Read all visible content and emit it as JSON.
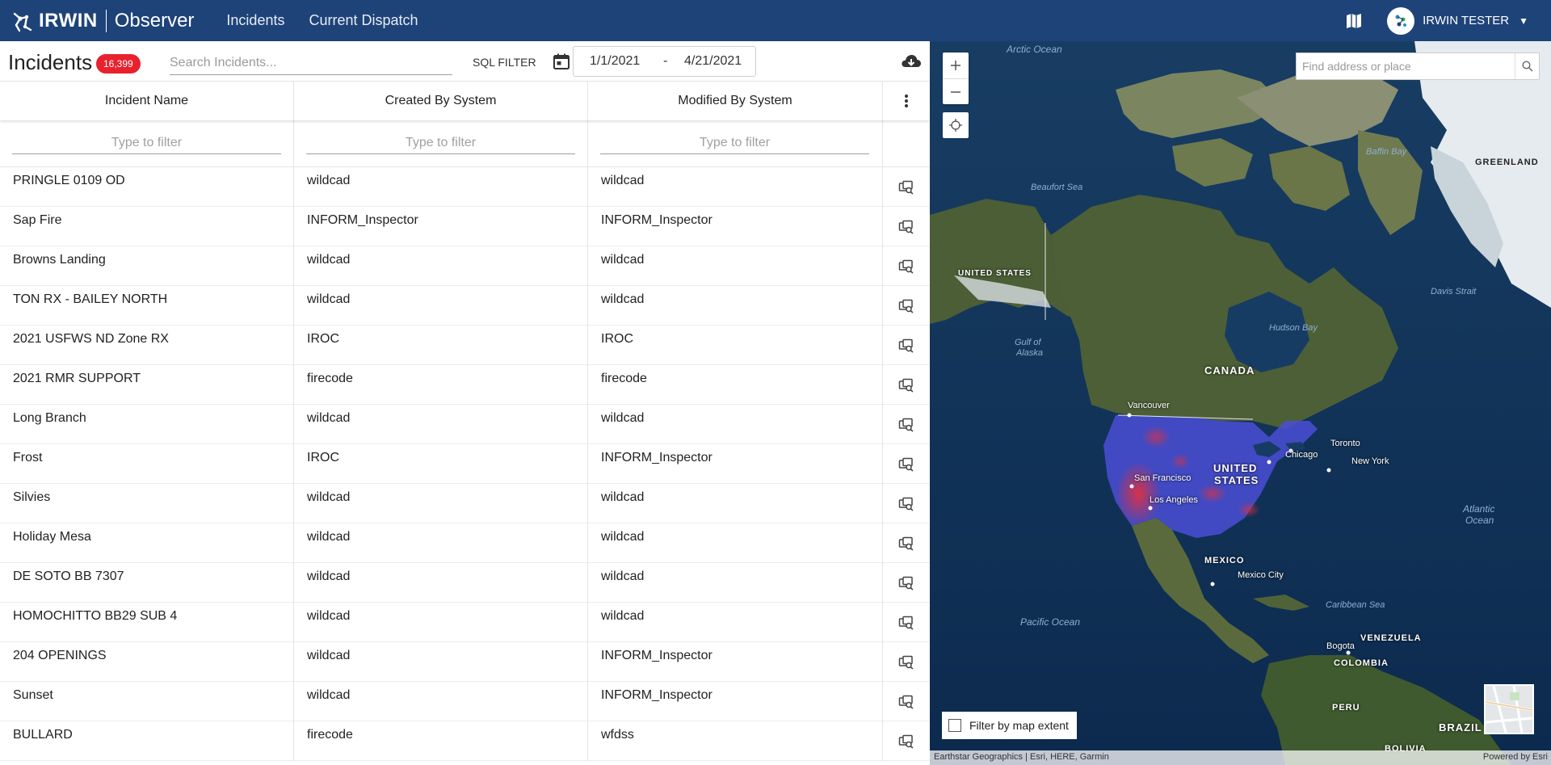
{
  "app": {
    "logo_text": "IRWIN",
    "app_name": "Observer",
    "nav": [
      "Incidents",
      "Current Dispatch"
    ],
    "user_name": "IRWIN TESTER"
  },
  "toolbar": {
    "title": "Incidents",
    "count": "16,399",
    "search_placeholder": "Search Incidents...",
    "sql_filter": "SQL FILTER",
    "date_from": "1/1/2021",
    "date_separator": "-",
    "date_to": "4/21/2021"
  },
  "table": {
    "columns": [
      "Incident Name",
      "Created By System",
      "Modified By System"
    ],
    "filter_placeholder": "Type to filter",
    "rows": [
      [
        "PRINGLE 0109 OD",
        "wildcad",
        "wildcad"
      ],
      [
        "Sap Fire",
        "INFORM_Inspector",
        "INFORM_Inspector"
      ],
      [
        "Browns Landing",
        "wildcad",
        "wildcad"
      ],
      [
        "TON RX - BAILEY NORTH",
        "wildcad",
        "wildcad"
      ],
      [
        "2021 USFWS ND Zone RX",
        "IROC",
        "IROC"
      ],
      [
        "2021 RMR SUPPORT",
        "firecode",
        "firecode"
      ],
      [
        "Long Branch",
        "wildcad",
        "wildcad"
      ],
      [
        "Frost",
        "IROC",
        "INFORM_Inspector"
      ],
      [
        "Silvies",
        "wildcad",
        "wildcad"
      ],
      [
        "Holiday Mesa",
        "wildcad",
        "wildcad"
      ],
      [
        "DE SOTO BB 7307",
        "wildcad",
        "wildcad"
      ],
      [
        "HOMOCHITTO BB29 SUB 4",
        "wildcad",
        "wildcad"
      ],
      [
        "204 OPENINGS",
        "wildcad",
        "INFORM_Inspector"
      ],
      [
        "Sunset",
        "wildcad",
        "INFORM_Inspector"
      ],
      [
        "BULLARD",
        "firecode",
        "wfdss"
      ]
    ]
  },
  "map": {
    "place_search_placeholder": "Find address or place",
    "filter_extent_label": "Filter by map extent",
    "attribution_left": "Earthstar Geographics | Esri, HERE, Garmin",
    "attribution_right": "Powered by Esri",
    "labels": {
      "arctic_ocean": "Arctic Ocean",
      "baffin_bay": "Baffin Bay",
      "greenland": "GREENLAND",
      "beaufort_sea": "Beaufort Sea",
      "united_states_ak": "UNITED STATES",
      "davis_strait": "Davis Strait",
      "hudson_bay": "Hudson Bay",
      "gulf_of_alaska_1": "Gulf of",
      "gulf_of_alaska_2": "Alaska",
      "canada": "CANADA",
      "vancouver": "Vancouver",
      "toronto": "Toronto",
      "chicago": "Chicago",
      "new_york": "New York",
      "united_states_1": "UNITED",
      "united_states_2": "STATES",
      "san_francisco": "San Francisco",
      "los_angeles": "Los Angeles",
      "atlantic_1": "Atlantic",
      "atlantic_2": "Ocean",
      "mexico": "MEXICO",
      "mexico_city": "Mexico City",
      "caribbean_sea": "Caribbean Sea",
      "pacific_ocean": "Pacific Ocean",
      "venezuela": "VENEZUELA",
      "bogota": "Bogota",
      "colombia": "COLOMBIA",
      "peru": "PERU",
      "brazil": "BRAZIL",
      "bolivia": "BOLIVIA"
    }
  },
  "colors": {
    "header_bg": "#1e4379",
    "badge_red": "#e8212d",
    "ocean": "#0e2c52",
    "land": "#4a5a36",
    "ice": "#e6ebef",
    "heatmap_blue": "#3a3fd0",
    "heatmap_red": "#e03040"
  }
}
